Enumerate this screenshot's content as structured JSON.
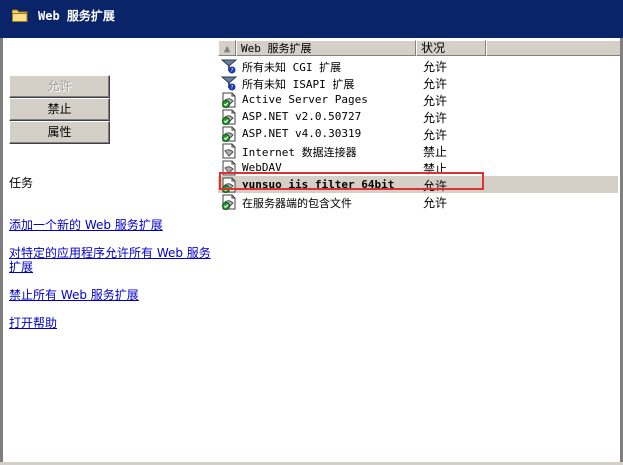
{
  "window": {
    "title": "Web 服务扩展",
    "icon": "folder-icon"
  },
  "buttons": {
    "allow": "允许",
    "prohibit": "禁止",
    "properties": "属性"
  },
  "tasks": {
    "label": "任务",
    "links": [
      "添加一个新的 Web 服务扩展",
      "对特定的应用程序允许所有 Web 服务扩展",
      "禁止所有 Web 服务扩展",
      "打开帮助"
    ]
  },
  "list": {
    "columns": {
      "name": "Web 服务扩展",
      "status": "状况"
    },
    "rows": [
      {
        "name": "所有未知 CGI 扩展",
        "status": "允许",
        "icon": "unknown-extension-icon"
      },
      {
        "name": "所有未知 ISAPI 扩展",
        "status": "允许",
        "icon": "unknown-extension-icon"
      },
      {
        "name": "Active Server Pages",
        "status": "允许",
        "icon": "allowed-extension-icon"
      },
      {
        "name": "ASP.NET v2.0.50727",
        "status": "允许",
        "icon": "allowed-extension-icon"
      },
      {
        "name": "ASP.NET v4.0.30319",
        "status": "允许",
        "icon": "allowed-extension-icon"
      },
      {
        "name": "Internet 数据连接器",
        "status": "禁止",
        "icon": "prohibited-extension-icon"
      },
      {
        "name": "WebDAV",
        "status": "禁止",
        "icon": "prohibited-extension-icon"
      },
      {
        "name": "yunsuo iis filter 64bit",
        "status": "允许",
        "icon": "allowed-extension-icon",
        "selected": true
      },
      {
        "name": "在服务器端的包含文件",
        "status": "允许",
        "icon": "allowed-extension-icon"
      }
    ]
  },
  "colors": {
    "titlebar": "#0a246a",
    "link": "#0000cc",
    "highlight_box": "#e03030",
    "button_face": "#d4d0c8"
  }
}
